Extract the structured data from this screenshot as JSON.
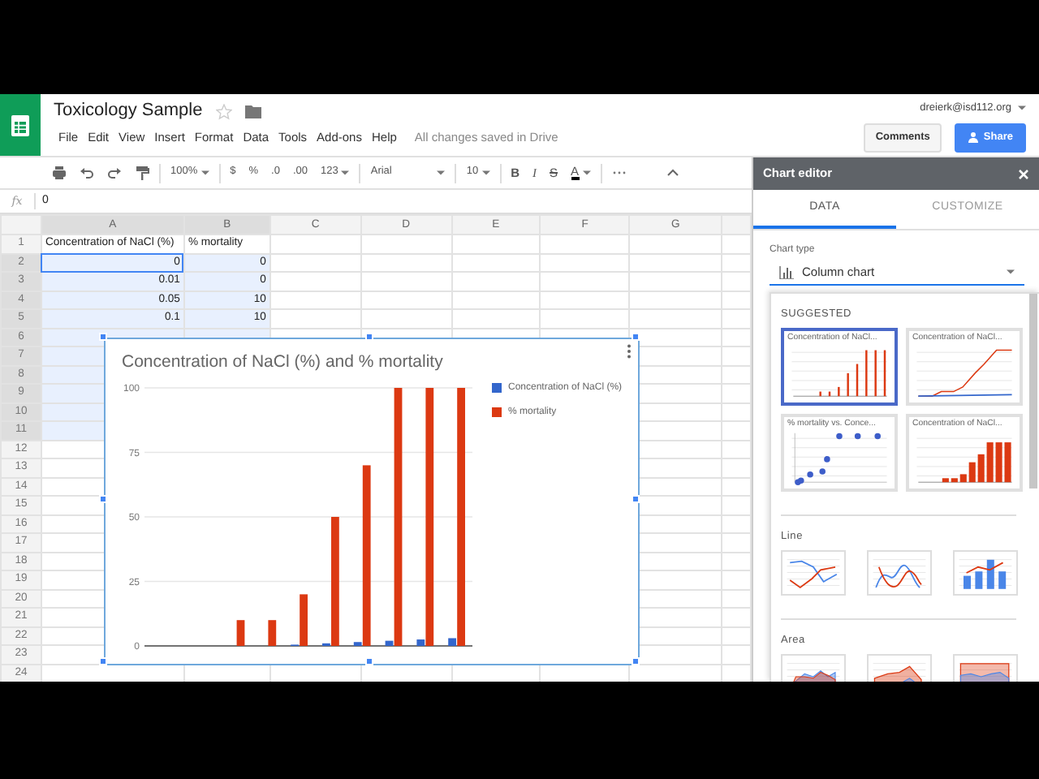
{
  "document": {
    "title": "Toxicology Sample",
    "menu": [
      "File",
      "Edit",
      "View",
      "Insert",
      "Format",
      "Data",
      "Tools",
      "Add-ons",
      "Help"
    ],
    "save_status": "All changes saved in Drive"
  },
  "account": {
    "email": "dreierk@isd112.org",
    "comments_button": "Comments",
    "share_button": "Share"
  },
  "toolbar": {
    "zoom": "100%",
    "currency": "$",
    "percent": "%",
    "decimals_less": ".0",
    "decimals_more": ".00",
    "number_format": "123",
    "font": "Arial",
    "font_size": "10",
    "bold": "B",
    "italic": "I",
    "strikethrough": "S",
    "text_color": "A"
  },
  "formula_bar": {
    "label": "fx",
    "value": "0"
  },
  "sheet": {
    "columns": [
      {
        "label": "A",
        "selected": true
      },
      {
        "label": "B",
        "selected": true
      },
      {
        "label": "C",
        "selected": false
      },
      {
        "label": "D",
        "selected": false
      },
      {
        "label": "E",
        "selected": false
      },
      {
        "label": "F",
        "selected": false
      },
      {
        "label": "G",
        "selected": false
      }
    ],
    "rows": [
      {
        "number": "1",
        "kind": "header",
        "selected": false,
        "active": false,
        "cells": [
          "Concentration of NaCl (%)",
          "% mortality"
        ]
      },
      {
        "number": "2",
        "kind": "data",
        "selected": true,
        "active": true,
        "cells": [
          "0",
          "0"
        ]
      },
      {
        "number": "3",
        "kind": "data",
        "selected": true,
        "active": false,
        "cells": [
          "0.01",
          "0"
        ]
      },
      {
        "number": "4",
        "kind": "data",
        "selected": true,
        "active": false,
        "cells": [
          "0.05",
          "10"
        ]
      },
      {
        "number": "5",
        "kind": "data",
        "selected": true,
        "active": false,
        "cells": [
          "0.1",
          "10"
        ]
      },
      {
        "number": "6",
        "kind": "data",
        "selected": true,
        "active": false
      },
      {
        "number": "7",
        "kind": "data",
        "selected": true,
        "active": false
      },
      {
        "number": "8",
        "kind": "data",
        "selected": true,
        "active": false
      },
      {
        "number": "9",
        "kind": "data",
        "selected": true,
        "active": false
      },
      {
        "number": "10",
        "kind": "data",
        "selected": true,
        "active": false
      },
      {
        "number": "11",
        "kind": "data",
        "selected": true,
        "active": false
      },
      {
        "number": "12",
        "kind": "data",
        "selected": false,
        "active": false
      },
      {
        "number": "13",
        "kind": "data",
        "selected": false,
        "active": false
      },
      {
        "number": "14",
        "kind": "data",
        "selected": false,
        "active": false
      },
      {
        "number": "15",
        "kind": "data",
        "selected": false,
        "active": false
      },
      {
        "number": "16",
        "kind": "data",
        "selected": false,
        "active": false
      },
      {
        "number": "17",
        "kind": "data",
        "selected": false,
        "active": false
      },
      {
        "number": "18",
        "kind": "data",
        "selected": false,
        "active": false
      },
      {
        "number": "19",
        "kind": "data",
        "selected": false,
        "active": false
      },
      {
        "number": "20",
        "kind": "data",
        "selected": false,
        "active": false
      },
      {
        "number": "21",
        "kind": "data",
        "selected": false,
        "active": false
      },
      {
        "number": "22",
        "kind": "data",
        "selected": false,
        "active": false
      },
      {
        "number": "23",
        "kind": "data",
        "selected": false,
        "active": false
      },
      {
        "number": "24",
        "kind": "data",
        "selected": false,
        "active": false
      }
    ]
  },
  "chart": {
    "chart_data": {
      "type": "bar",
      "grid": true,
      "legend": "right",
      "title": "Concentration of NaCl (%) and % mortality",
      "ylim": [
        0,
        100
      ],
      "yticks": [
        0,
        25,
        50,
        75,
        100
      ],
      "series": [
        {
          "name": "Concentration of NaCl (%)",
          "color": "#3366cc",
          "values": [
            0,
            0.01,
            0.05,
            0.1,
            0.5,
            1,
            1.5,
            2,
            2.5,
            3
          ]
        },
        {
          "name": "% mortality",
          "color": "#dc3912",
          "values": [
            0,
            0,
            10,
            10,
            20,
            50,
            70,
            100,
            100,
            100
          ]
        }
      ]
    }
  },
  "editor": {
    "title": "Chart editor",
    "tabs": [
      {
        "label": "DATA",
        "selected": true
      },
      {
        "label": "CUSTOMIZE",
        "selected": false
      }
    ],
    "chart_type_label": "Chart type",
    "chart_type": "Column chart",
    "sections": [
      {
        "heading": "SUGGESTED",
        "kind": "suggested",
        "thumbnails": [
          {
            "kind": "column",
            "caption": "Concentration of NaCl...",
            "selected": true
          },
          {
            "kind": "line",
            "caption": "Concentration of NaCl...",
            "selected": false
          },
          {
            "kind": "scatter",
            "caption": "% mortality  vs. Conce...",
            "selected": false
          },
          {
            "kind": "column-wide",
            "caption": "Concentration of NaCl...",
            "selected": false
          }
        ]
      },
      {
        "heading": "Line",
        "kind": "small",
        "thumbnails": [
          {
            "kind": "line-cross",
            "selected": false
          },
          {
            "kind": "line-smooth",
            "selected": false
          },
          {
            "kind": "combo",
            "selected": false
          }
        ]
      },
      {
        "heading": "Area",
        "kind": "small",
        "thumbnails": [
          {
            "kind": "area",
            "selected": false
          },
          {
            "kind": "area-stacked",
            "selected": false
          },
          {
            "kind": "area-full",
            "selected": false
          }
        ]
      }
    ]
  }
}
